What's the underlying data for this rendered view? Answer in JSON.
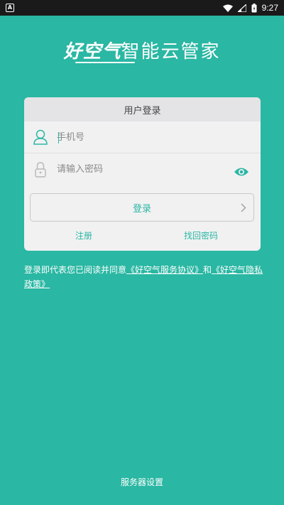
{
  "statusbar": {
    "app_icon": "A",
    "time": "9:27"
  },
  "logo": {
    "brand": "好空气",
    "subtitle": "智能云管家"
  },
  "login_card": {
    "title": "用户登录",
    "phone_placeholder": "手机号",
    "password_placeholder": "请输入密码",
    "login_label": "登录",
    "register_label": "注册",
    "recover_label": "找回密码"
  },
  "agreement": {
    "prefix": "登录即代表您已阅读并同意",
    "service_link": "《好空气服务协议》",
    "and": "和",
    "privacy_link": "《好空气隐私政策》"
  },
  "footer": {
    "server_settings": "服务器设置"
  },
  "colors": {
    "background": "#2ab7a3",
    "accent": "#2ab7a3",
    "card": "#f1f1f2"
  },
  "icons": {
    "phone_field": "user-icon",
    "password_field": "lock-icon",
    "show_password": "eye-icon",
    "login_arrow": "chevron-right-icon"
  }
}
